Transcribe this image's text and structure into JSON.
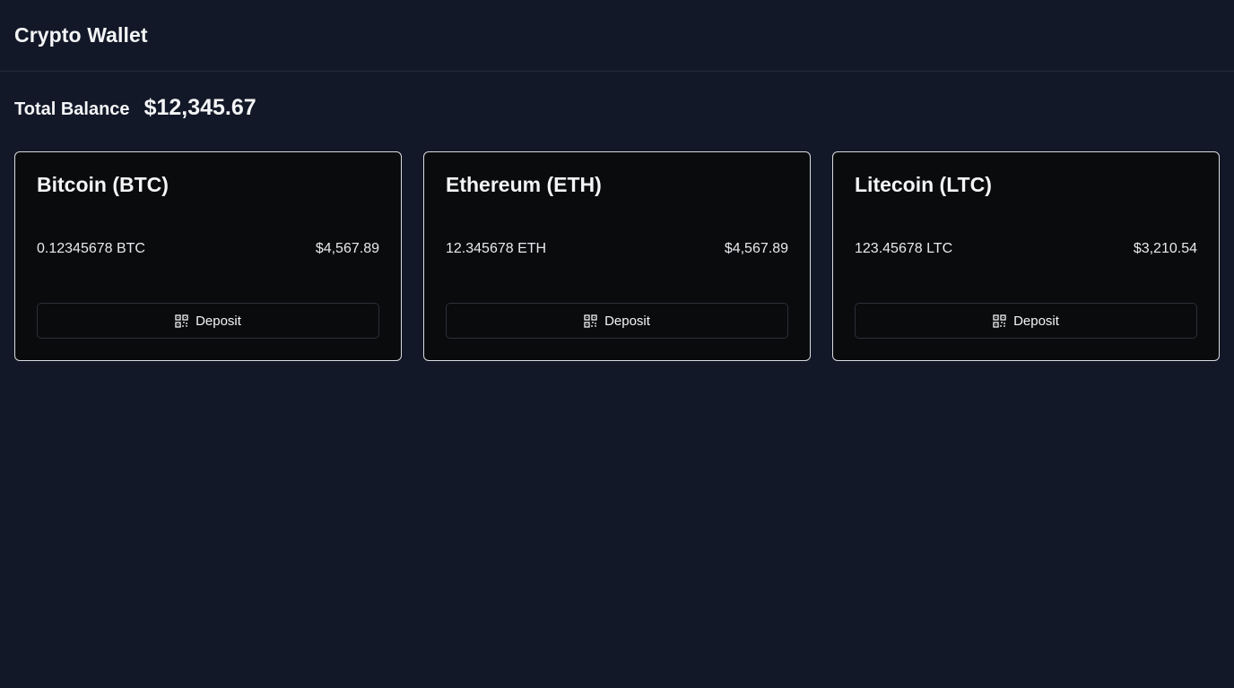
{
  "header": {
    "title": "Crypto Wallet"
  },
  "balance": {
    "label": "Total Balance",
    "value": "$12,345.67"
  },
  "cards": [
    {
      "name": "Bitcoin (BTC)",
      "amount": "0.12345678 BTC",
      "value": "$4,567.89",
      "button_label": "Deposit",
      "button_icon": "qr-code-icon"
    },
    {
      "name": "Ethereum (ETH)",
      "amount": "12.345678 ETH",
      "value": "$4,567.89",
      "button_label": "Deposit",
      "button_icon": "qr-code-icon"
    },
    {
      "name": "Litecoin (LTC)",
      "amount": "123.45678 LTC",
      "value": "$3,210.54",
      "button_label": "Deposit",
      "button_icon": "qr-code-icon"
    }
  ],
  "colors": {
    "background": "#121827",
    "card_background": "#0a0b0d",
    "card_border": "#d8dbe0",
    "text": "#f4f5f7"
  }
}
